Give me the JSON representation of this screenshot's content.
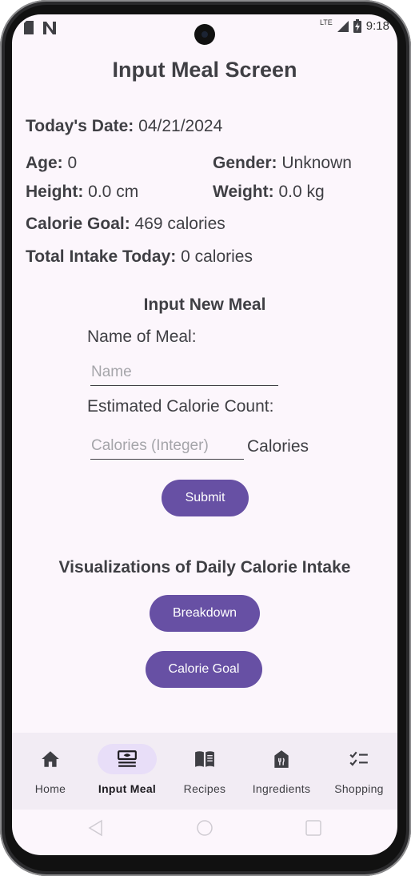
{
  "status_bar": {
    "time": "9:18",
    "network": "LTE"
  },
  "screen_title": "Input Meal Screen",
  "profile": {
    "date_label": "Today's Date:",
    "date_value": "04/21/2024",
    "age_label": "Age:",
    "age_value": "0",
    "gender_label": "Gender:",
    "gender_value": "Unknown",
    "height_label": "Height:",
    "height_value": "0.0 cm",
    "weight_label": "Weight:",
    "weight_value": "0.0 kg",
    "goal_label": "Calorie Goal:",
    "goal_value": "469 calories",
    "intake_label": "Total Intake Today:",
    "intake_value": "0 calories"
  },
  "meal_form": {
    "heading": "Input New Meal",
    "name_label": "Name of Meal:",
    "name_placeholder": "Name",
    "name_value": "",
    "calorie_label": "Estimated Calorie Count:",
    "calorie_placeholder": "Calories (Integer)",
    "calorie_value": "",
    "calorie_unit": "Calories",
    "submit_label": "Submit"
  },
  "visualizations": {
    "heading": "Visualizations of Daily Calorie Intake",
    "breakdown_label": "Breakdown",
    "goal_label": "Calorie Goal"
  },
  "bottom_nav": {
    "items": [
      {
        "label": "Home",
        "icon": "home-icon",
        "active": false
      },
      {
        "label": "Input Meal",
        "icon": "meal-icon",
        "active": true
      },
      {
        "label": "Recipes",
        "icon": "book-icon",
        "active": false
      },
      {
        "label": "Ingredients",
        "icon": "restaurant-icon",
        "active": false
      },
      {
        "label": "Shopping",
        "icon": "checklist-icon",
        "active": false
      }
    ]
  },
  "colors": {
    "accent": "#6750a4",
    "background": "#fcf6fc",
    "nav_background": "#f2ecf4",
    "active_pill": "#e8def8",
    "text": "#3f3f44"
  }
}
